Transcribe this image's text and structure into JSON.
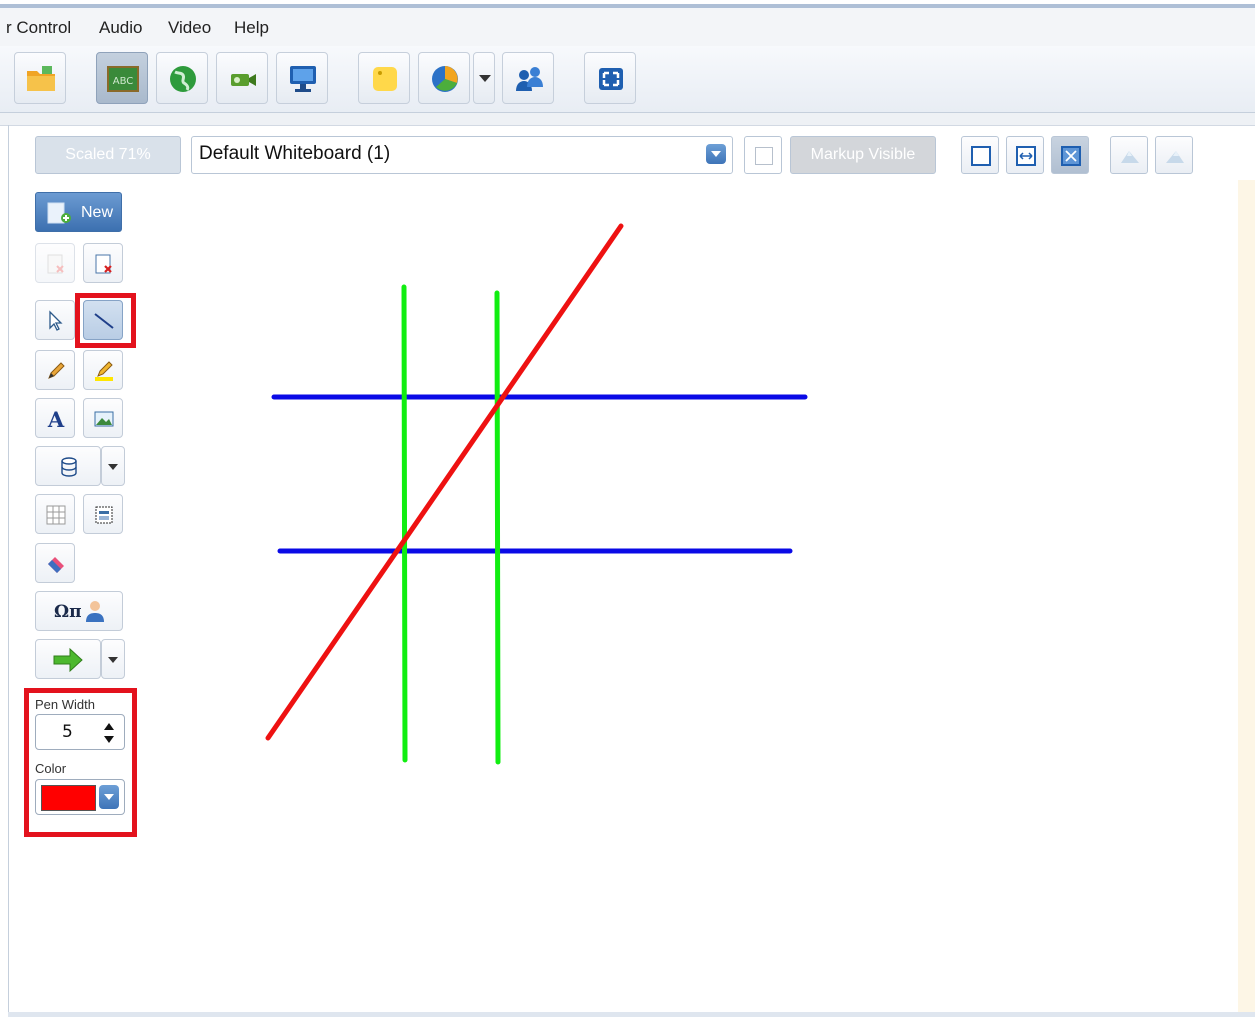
{
  "menu": {
    "items": [
      "r Control",
      "Audio",
      "Video",
      "Help"
    ]
  },
  "toolbar": {
    "buttons": [
      {
        "icon": "folder-icon"
      },
      {
        "icon": "whiteboard-icon",
        "label": "ABC",
        "active": true
      },
      {
        "icon": "globe-icon"
      },
      {
        "icon": "video-camera-icon"
      },
      {
        "icon": "monitor-icon"
      },
      {
        "icon": "sticky-note-icon"
      },
      {
        "icon": "pie-chart-icon"
      },
      {
        "icon": "users-icon"
      },
      {
        "icon": "fullscreen-icon"
      }
    ]
  },
  "whiteboard": {
    "scale_label": "Scaled 71%",
    "selected_board": "Default Whiteboard (1)",
    "markup_label": "Markup Visible"
  },
  "tools": {
    "new_label": "New",
    "symbols_label": "Ωπ",
    "pen_width_label": "Pen Width",
    "pen_width_value": "5",
    "color_label": "Color",
    "selected_color": "#ff0000",
    "active_tool": "line"
  },
  "canvas": {
    "stroke_colors": {
      "red": "#ee1111",
      "green": "#11ee11",
      "blue": "#0a0ae6"
    }
  }
}
